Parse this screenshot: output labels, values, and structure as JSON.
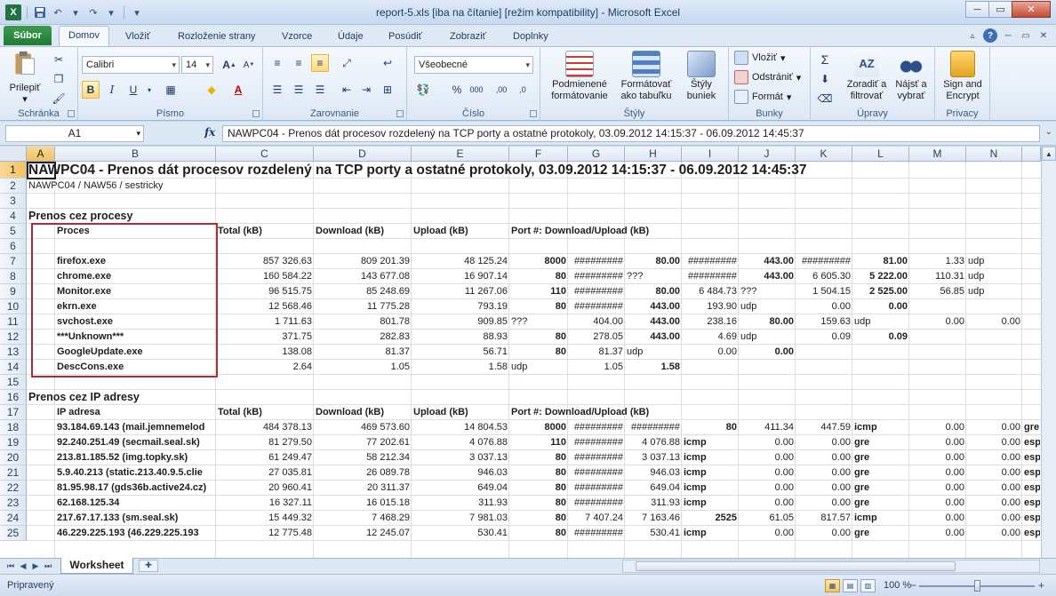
{
  "window": {
    "title": "report-5.xls  [iba na čítanie]  [režim kompatibility]  -  Microsoft Excel",
    "minimize": "─",
    "restore": "▭",
    "close": "✕"
  },
  "qat": {
    "logo": "X",
    "save": "💾",
    "undo": "↶",
    "redo": "↷",
    "customize": "▾"
  },
  "ribbon_tabs": {
    "file": "Súbor",
    "items": [
      "Domov",
      "Vložiť",
      "Rozloženie strany",
      "Vzorce",
      "Údaje",
      "Posúdiť",
      "Zobraziť",
      "Doplnky"
    ]
  },
  "ribbon": {
    "clipboard": {
      "label": "Schránka",
      "paste": "Prilepiť"
    },
    "font": {
      "label": "Písmo",
      "name": "Calibri",
      "size": "14",
      "grow": "A",
      "shrink": "A",
      "bold": "B",
      "italic": "I",
      "underline": "U",
      "color_letter": "A"
    },
    "alignment": {
      "label": "Zarovnanie"
    },
    "number": {
      "label": "Číslo",
      "format": "Všeobecné",
      "percent": "%",
      "thousands": "000",
      "inc_dec": ",00",
      "dec_dec": ",0"
    },
    "styles": {
      "label": "Štýly",
      "conditional": "Podmienené formátovanie",
      "table": "Formátovať ako tabuľku",
      "cell_styles": "Štýly buniek"
    },
    "cells": {
      "label": "Bunky",
      "insert": "Vložiť",
      "delete": "Odstrániť",
      "format": "Formát"
    },
    "editing": {
      "label": "Úpravy",
      "sum": "Σ",
      "sort": "Zoradiť a filtrovať",
      "find": "Nájsť a vybrať"
    },
    "privacy": {
      "label": "Privacy",
      "sign": "Sign and Encrypt"
    }
  },
  "formula_bar": {
    "name_box": "A1",
    "fx": "fx",
    "value": "NAWPC04 - Prenos dát procesov rozdelený na TCP porty a ostatné protokoly, 03.09.2012 14:15:37 - 06.09.2012 14:45:37"
  },
  "columns": [
    "A",
    "B",
    "C",
    "D",
    "E",
    "F",
    "G",
    "H",
    "I",
    "J",
    "K",
    "L",
    "M",
    "N"
  ],
  "rows": [
    "1",
    "2",
    "3",
    "4",
    "5",
    "6",
    "7",
    "8",
    "9",
    "10",
    "11",
    "12",
    "13",
    "14",
    "15",
    "16",
    "17",
    "18",
    "19",
    "20",
    "21",
    "22",
    "23",
    "24",
    "25"
  ],
  "sheet": {
    "title": "NAWPC04 - Prenos dát procesov rozdelený na TCP porty a ostatné protokoly, 03.09.2012 14:15:37 - 06.09.2012 14:45:37",
    "subtitle": "NAWPC04 / NAW56 / sestricky",
    "sec1": "Prenos cez procesy",
    "sec2": "Prenos cez IP adresy",
    "hdr_proces": "Proces",
    "hdr_ip": "IP adresa",
    "hdr_total": "Total (kB)",
    "hdr_download": "Download (kB)",
    "hdr_upload": "Upload (kB)",
    "hdr_port": "Port #: Download/Upload (kB)",
    "process_rows": [
      {
        "r": 7,
        "b": "firefox.exe",
        "c": "857 326.63",
        "d": "809 201.39",
        "e": "48 125.24",
        "f": "8000",
        "g": "#########",
        "h": "80.00",
        "i": "#########",
        "j": "443.00",
        "k": "#########",
        "l": "81.00",
        "m": "1.33",
        "n": "udp"
      },
      {
        "r": 8,
        "b": "chrome.exe",
        "c": "160 584.22",
        "d": "143 677.08",
        "e": "16 907.14",
        "f": "80",
        "g": "#########",
        "h": "???",
        "i": "#########",
        "j": "443.00",
        "k": "6 605.30",
        "l": "5 222.00",
        "m": "110.31",
        "n": "udp"
      },
      {
        "r": 9,
        "b": "Monitor.exe",
        "c": "96 515.75",
        "d": "85 248.69",
        "e": "11 267.06",
        "f": "110",
        "g": "#########",
        "h": "80.00",
        "i": "6 484.73",
        "j": "???",
        "k": "1 504.15",
        "l": "2 525.00",
        "m": "56.85",
        "n": "udp"
      },
      {
        "r": 10,
        "b": "ekrn.exe",
        "c": "12 568.46",
        "d": "11 775.28",
        "e": "793.19",
        "f": "80",
        "g": "#########",
        "h": "443.00",
        "i": "193.90",
        "j": "udp",
        "k": "0.00",
        "l": "0.00",
        "m": "",
        "n": ""
      },
      {
        "r": 11,
        "b": "svchost.exe",
        "c": "1 711.63",
        "d": "801.78",
        "e": "909.85",
        "f": "???",
        "g": "404.00",
        "h": "443.00",
        "i": "238.16",
        "j": "80.00",
        "k": "159.63",
        "l": "udp",
        "m": "0.00",
        "n": "0.00"
      },
      {
        "r": 12,
        "b": "***Unknown***",
        "c": "371.75",
        "d": "282.83",
        "e": "88.93",
        "f": "80",
        "g": "278.05",
        "h": "443.00",
        "i": "4.69",
        "j": "udp",
        "k": "0.09",
        "l": "0.09",
        "m": "",
        "n": ""
      },
      {
        "r": 13,
        "b": "GoogleUpdate.exe",
        "c": "138.08",
        "d": "81.37",
        "e": "56.71",
        "f": "80",
        "g": "81.37",
        "h": "udp",
        "i": "0.00",
        "j": "0.00",
        "k": "",
        "l": "",
        "m": "",
        "n": ""
      },
      {
        "r": 14,
        "b": "DescCons.exe",
        "c": "2.64",
        "d": "1.05",
        "e": "1.58",
        "f": "udp",
        "g": "1.05",
        "h": "1.58",
        "i": "",
        "j": "",
        "k": "",
        "l": "",
        "m": "",
        "n": ""
      }
    ],
    "ip_rows": [
      {
        "r": 18,
        "b": "93.184.69.143 (mail.jemnemelod",
        "c": "484 378.13",
        "d": "469 573.60",
        "e": "14 804.53",
        "f": "8000",
        "g": "#########",
        "h": "#########",
        "i": "80",
        "j": "411.34",
        "k": "447.59",
        "l": "icmp",
        "m": "0.00",
        "n": "0.00",
        "o": "gre"
      },
      {
        "r": 19,
        "b": "92.240.251.49 (secmail.seal.sk)",
        "c": "81 279.50",
        "d": "77 202.61",
        "e": "4 076.88",
        "f": "110",
        "g": "#########",
        "h": "4 076.88",
        "i": "icmp",
        "j": "0.00",
        "k": "0.00",
        "l": "gre",
        "m": "0.00",
        "n": "0.00",
        "o": "esp"
      },
      {
        "r": 20,
        "b": "213.81.185.52 (img.topky.sk)",
        "c": "61 249.47",
        "d": "58 212.34",
        "e": "3 037.13",
        "f": "80",
        "g": "#########",
        "h": "3 037.13",
        "i": "icmp",
        "j": "0.00",
        "k": "0.00",
        "l": "gre",
        "m": "0.00",
        "n": "0.00",
        "o": "esp"
      },
      {
        "r": 21,
        "b": "5.9.40.213 (static.213.40.9.5.clie",
        "c": "27 035.81",
        "d": "26 089.78",
        "e": "946.03",
        "f": "80",
        "g": "#########",
        "h": "946.03",
        "i": "icmp",
        "j": "0.00",
        "k": "0.00",
        "l": "gre",
        "m": "0.00",
        "n": "0.00",
        "o": "esp"
      },
      {
        "r": 22,
        "b": "81.95.98.17 (gds36b.active24.cz)",
        "c": "20 960.41",
        "d": "20 311.37",
        "e": "649.04",
        "f": "80",
        "g": "#########",
        "h": "649.04",
        "i": "icmp",
        "j": "0.00",
        "k": "0.00",
        "l": "gre",
        "m": "0.00",
        "n": "0.00",
        "o": "esp"
      },
      {
        "r": 23,
        "b": "62.168.125.34",
        "c": "16 327.11",
        "d": "16 015.18",
        "e": "311.93",
        "f": "80",
        "g": "#########",
        "h": "311.93",
        "i": "icmp",
        "j": "0.00",
        "k": "0.00",
        "l": "gre",
        "m": "0.00",
        "n": "0.00",
        "o": "esp"
      },
      {
        "r": 24,
        "b": "217.67.17.133 (sm.seal.sk)",
        "c": "15 449.32",
        "d": "7 468.29",
        "e": "7 981.03",
        "f": "80",
        "g": "7 407.24",
        "h": "7 163.46",
        "i": "2525",
        "j": "61.05",
        "k": "817.57",
        "l": "icmp",
        "m": "0.00",
        "n": "0.00",
        "o": "esp"
      },
      {
        "r": 25,
        "b": "46.229.225.193 (46.229.225.193",
        "c": "12 775.48",
        "d": "12 245.07",
        "e": "530.41",
        "f": "80",
        "g": "#########",
        "h": "530.41",
        "i": "icmp",
        "j": "0.00",
        "k": "0.00",
        "l": "gre",
        "m": "0.00",
        "n": "0.00",
        "o": "esp"
      }
    ]
  },
  "sheet_tabs": {
    "active": "Worksheet",
    "new": "✚"
  },
  "status_bar": {
    "status": "Pripravený",
    "zoom": "100 %",
    "minus": "−",
    "plus": "+"
  }
}
